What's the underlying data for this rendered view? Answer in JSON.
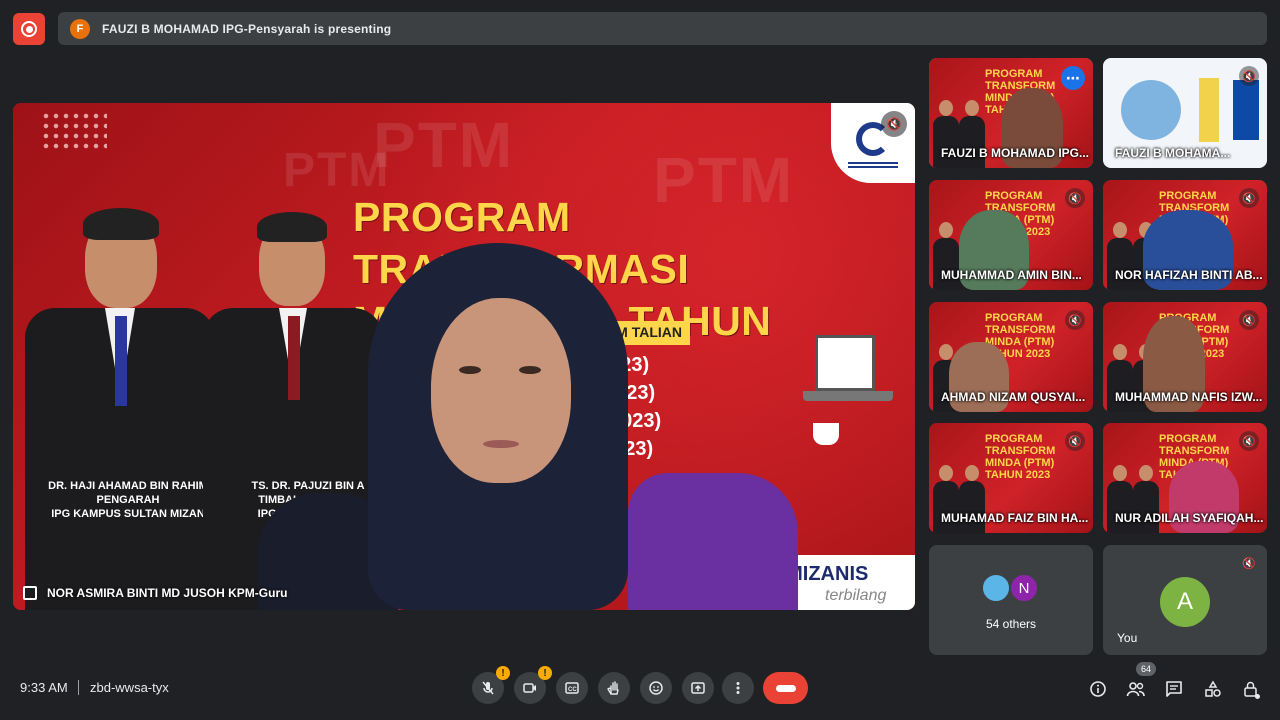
{
  "header": {
    "presenter_initial": "F",
    "presenting_text": "FAUZI B MOHAMAD IPG-Pensyarah is presenting"
  },
  "stage": {
    "slide": {
      "title_line1": "PROGRAM TRANSFORMASI",
      "title_line2": "MINDA (PTM) TAHUN 2023",
      "strip_text": "DALAM TALIAN",
      "sessions": [
        "2023)",
        "2023)",
        "2023)",
        "2023)"
      ],
      "person1_caption": [
        "DR. HAJI AHAMAD BIN RAHIM",
        "PENGARAH",
        "IPG KAMPUS SULTAN MIZAN"
      ],
      "person2_caption": [
        "TS. DR. PAJUZI BIN A",
        "TIMBALAN PENGA",
        "IPG KAMPUS SULT"
      ],
      "footer_brand": "#MIZANIS",
      "footer_tag": "terbilang",
      "ghost_text": "PTM"
    },
    "speaker_name": "NOR ASMIRA BINTI MD JUSOH KPM-Guru"
  },
  "tiles": [
    {
      "name": "FAUZI B MOHAMAD IPG...",
      "active": true
    },
    {
      "name": "FAUZI B MOHAMA..."
    },
    {
      "name": "MUHAMMAD AMIN BIN..."
    },
    {
      "name": "NOR HAFIZAH BINTI AB..."
    },
    {
      "name": "AHMAD NIZAM QUSYAI..."
    },
    {
      "name": "MUHAMMAD NAFIS IZW..."
    },
    {
      "name": "MUHAMAD FAIZ BIN HA..."
    },
    {
      "name": "NUR ADILAH SYAFIQAH..."
    }
  ],
  "thumb_title": "PROGRAM TRANSFORM MINDA (PTM) TAHUN 2023",
  "others": {
    "avatar_letter": "N",
    "label": "54 others"
  },
  "you": {
    "avatar_letter": "A",
    "label": "You"
  },
  "bottom": {
    "time": "9:33 AM",
    "meeting_code": "zbd-wwsa-tyx",
    "people_count": "64",
    "warn_mark": "!"
  },
  "icons": {
    "record": "record-icon",
    "mic": "mic-off-icon",
    "camera": "camera-off-icon",
    "captions": "captions-icon",
    "hand": "raise-hand-icon",
    "emoji": "emoji-icon",
    "present": "present-screen-icon",
    "more": "more-vert-icon",
    "hangup": "call-end-icon",
    "info": "info-icon",
    "people": "people-icon",
    "chat": "chat-icon",
    "activities": "activities-icon",
    "host": "host-controls-icon"
  },
  "colors": {
    "background": "#202124",
    "surface": "#3c4043",
    "hangup_red": "#ea4335",
    "accent_blue": "#1a73e8",
    "warning": "#f9ab00"
  }
}
